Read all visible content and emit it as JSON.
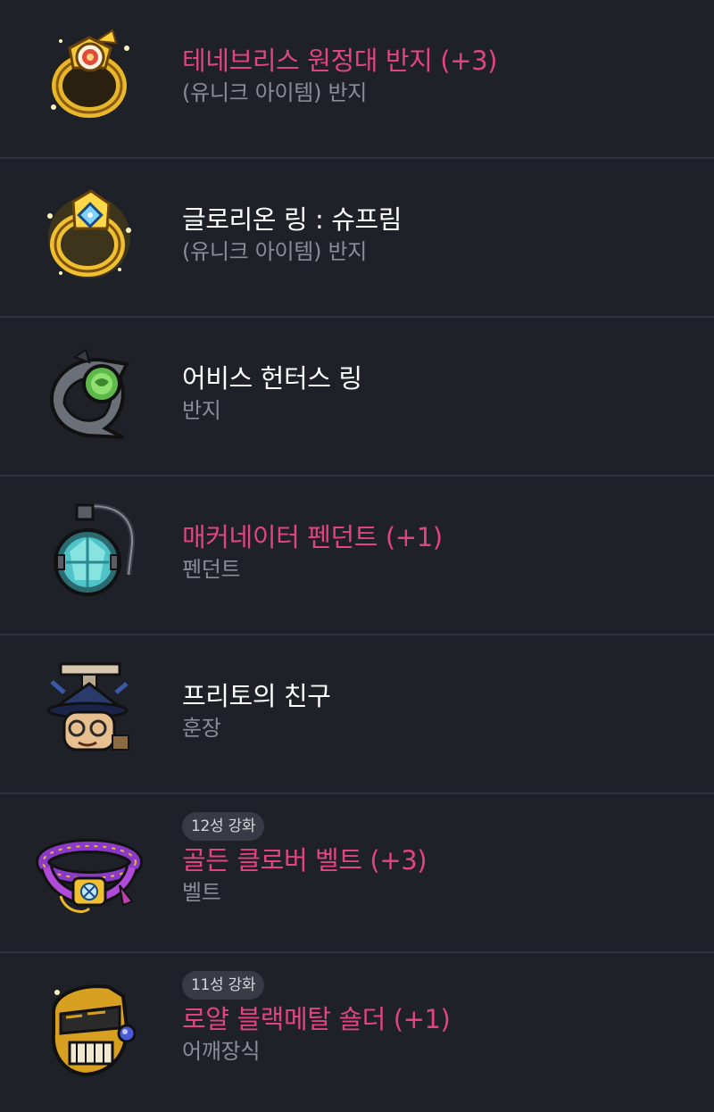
{
  "items": [
    {
      "name": "테네브리스 원정대 반지 (+3)",
      "type": "(유니크 아이템) 반지",
      "badge": "",
      "icon": "tenebris-expedition-ring-icon",
      "enhanced": true
    },
    {
      "name": "글로리온 링 : 슈프림",
      "type": "(유니크 아이템) 반지",
      "badge": "",
      "icon": "glorion-ring-icon",
      "enhanced": false
    },
    {
      "name": "어비스 헌터스 링",
      "type": "반지",
      "badge": "",
      "icon": "abyss-hunters-ring-icon",
      "enhanced": false
    },
    {
      "name": "매커네이터 펜던트 (+1)",
      "type": "펜던트",
      "badge": "",
      "icon": "mechanator-pendant-icon",
      "enhanced": true
    },
    {
      "name": "프리토의 친구",
      "type": "훈장",
      "badge": "",
      "icon": "frito-medal-icon",
      "enhanced": false
    },
    {
      "name": "골든 클로버 벨트 (+3)",
      "type": "벨트",
      "badge": "12성 강화",
      "icon": "golden-clover-belt-icon",
      "enhanced": true
    },
    {
      "name": "로얄 블랙메탈 숄더 (+1)",
      "type": "어깨장식",
      "badge": "11성 강화",
      "icon": "royal-blackmetal-shoulder-icon",
      "enhanced": true
    }
  ],
  "colors": {
    "background": "#1f2128",
    "divider": "#31343d",
    "enhanced_name": "#e0457f",
    "normal_name": "#ffffff",
    "type_text": "#8a8d96",
    "badge_bg": "#383b45"
  }
}
